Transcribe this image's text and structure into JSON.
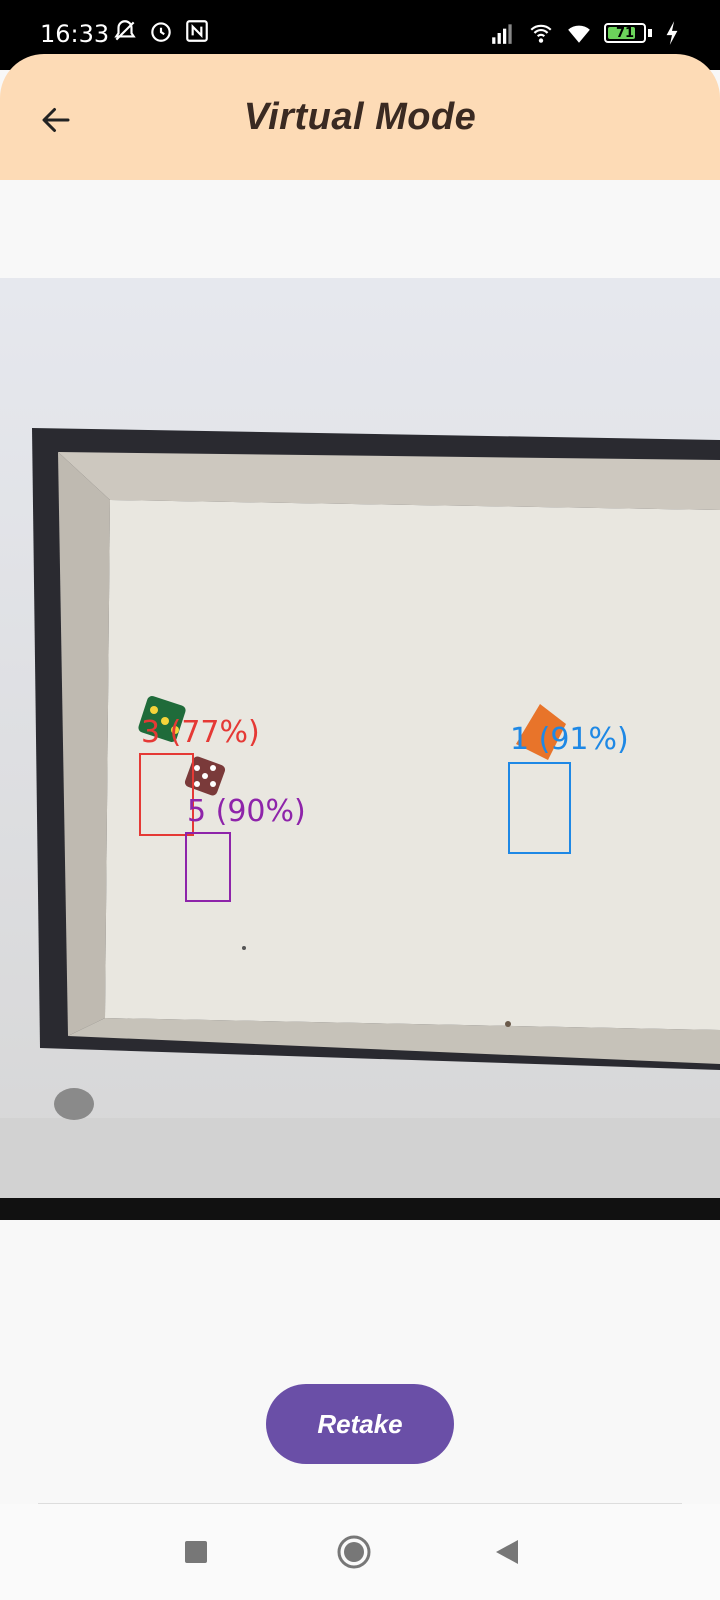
{
  "status_bar": {
    "time": "16:33",
    "battery_level": "71",
    "left_icons": [
      "mute-alarm-icon",
      "alarm-icon",
      "nfc-icon"
    ],
    "right_icons": [
      "signal-icon",
      "hotspot-icon",
      "wifi-icon",
      "battery-icon",
      "charging-icon"
    ]
  },
  "header": {
    "title": "Virtual Mode",
    "back_icon": "back-arrow-icon",
    "background": "#fddbb6"
  },
  "detections": [
    {
      "label": "3 (77%)",
      "value": 3,
      "confidence": 77,
      "color": "#e53935"
    },
    {
      "label": "5 (90%)",
      "value": 5,
      "confidence": 90,
      "color": "#8e24aa"
    },
    {
      "label": "1 (91%)",
      "value": 1,
      "confidence": 91,
      "color": "#1e88e5"
    }
  ],
  "actions": {
    "retake_label": "Retake",
    "retake_color": "#6a4fa7"
  },
  "nav": [
    "recents-square-icon",
    "home-circle-icon",
    "back-triangle-icon"
  ]
}
